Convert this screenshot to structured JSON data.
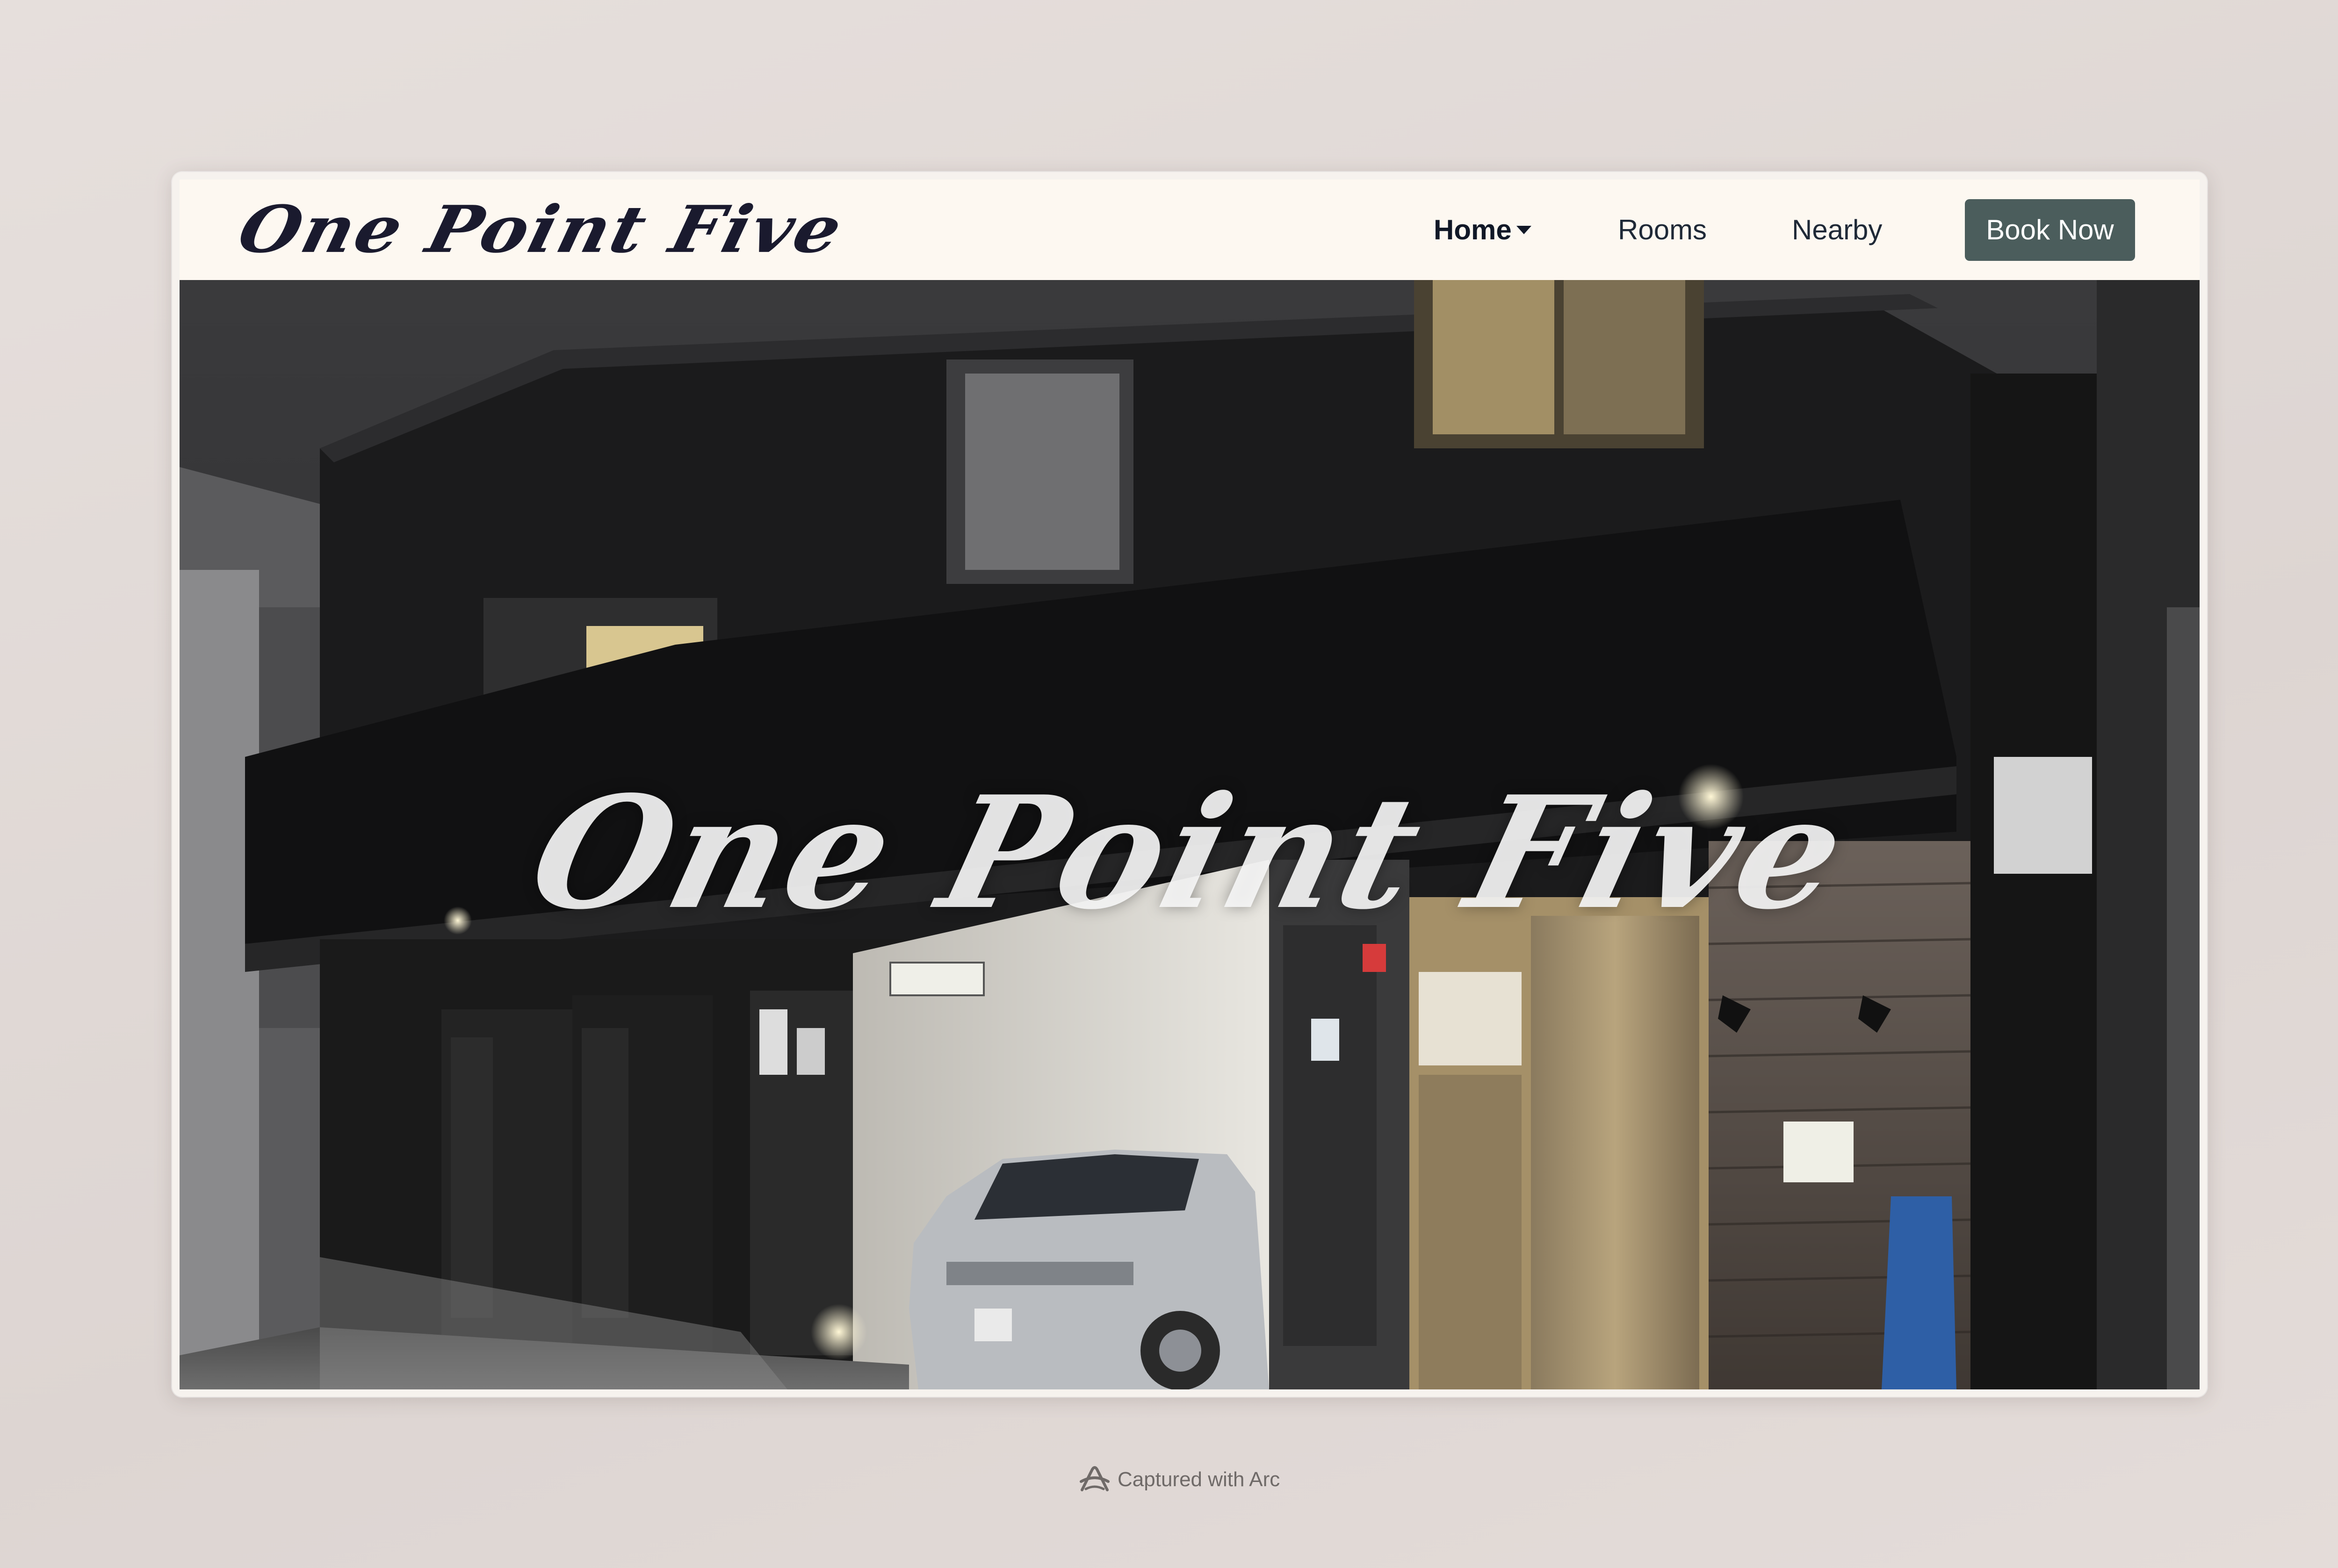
{
  "navbar": {
    "logo_text": "One Point Five",
    "items": [
      {
        "label": "Home",
        "active": true,
        "has_dropdown": true
      },
      {
        "label": "Rooms",
        "active": false
      },
      {
        "label": "Nearby",
        "active": false
      }
    ],
    "cta_label": "Book Now"
  },
  "hero": {
    "title": "One Point Five",
    "image": "night-exterior-of-two-story-guesthouse-with-parked-silver-minivan"
  },
  "capture": {
    "text": "Captured with Arc",
    "icon": "arc-icon"
  },
  "colors": {
    "background": "#e2dad7",
    "navbar_bg": "#fdf8f1",
    "logo": "#1a1a2e",
    "nav_text": "#1f2937",
    "button_bg": "#4b5d5c",
    "button_text": "#ffffff",
    "hero_title": "#f5f5f5"
  }
}
